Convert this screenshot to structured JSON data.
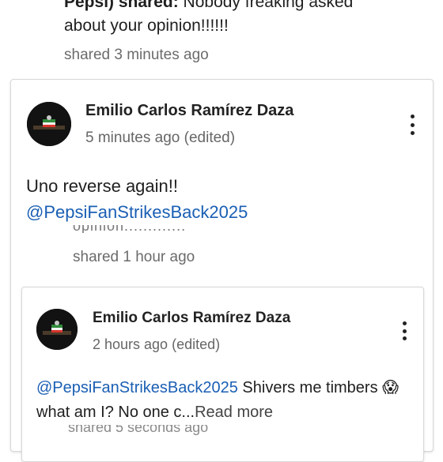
{
  "top_post": {
    "line1_bold": "Pepsi) shared:",
    "line1_rest": " Nobody freaking asked",
    "line2": "about your opinion!!!!!!",
    "meta": "shared 3 minutes ago"
  },
  "comment": {
    "author": "Emilio Carlos Ramírez Daza",
    "time": "5 minutes ago (edited)",
    "text": "Uno reverse again!!",
    "mention": "@PepsiFanStrikesBack2025",
    "quoted_faded": "opinion.............",
    "shared_meta": "shared 1 hour ago"
  },
  "nested_comment": {
    "author": "Emilio Carlos Ramírez Daza",
    "time": "2 hours ago (edited)",
    "mention": "@PepsiFanStrikesBack2025",
    "text_part1": " Shivers me timbers ",
    "emoji": "😱",
    "text_part2": " what am I? No one c...",
    "read_more": "Read more",
    "bottom_meta": "shared 5 seconds ago"
  },
  "icons": {
    "menu": "more-vert-icon",
    "avatar": "flag-avatar"
  },
  "colors": {
    "mention": "#1a5fb4",
    "meta_text": "#6b6b6b"
  }
}
